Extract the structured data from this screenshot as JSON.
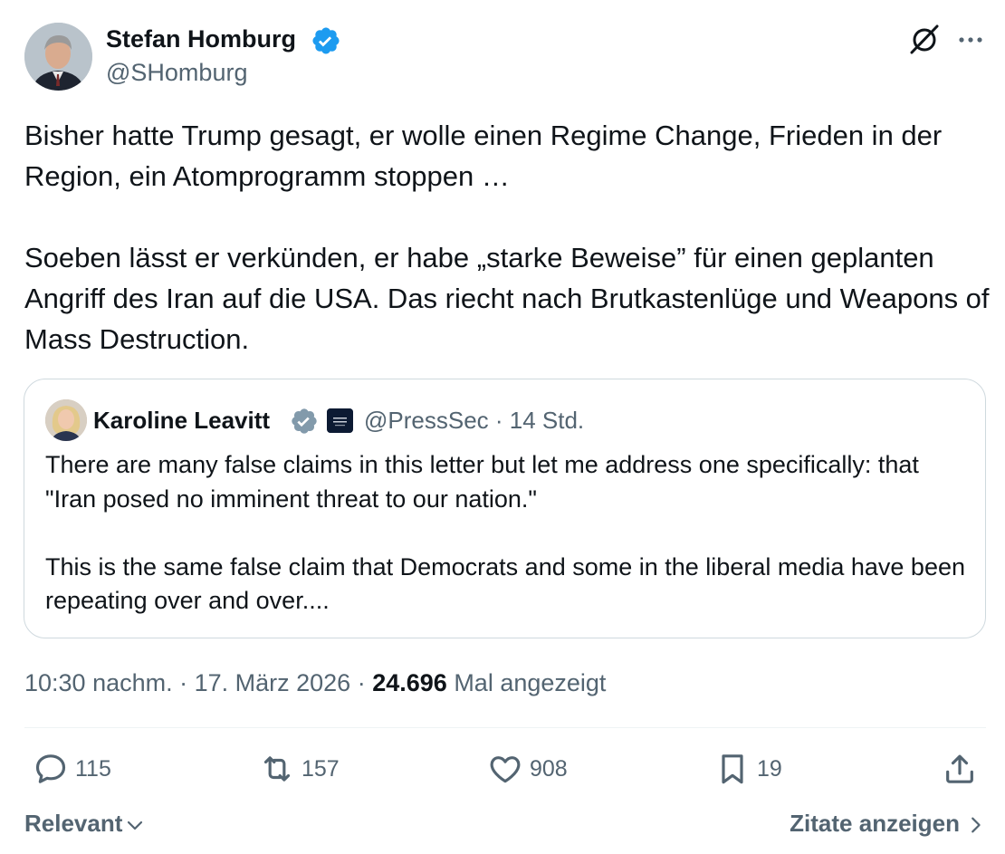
{
  "author": {
    "name": "Stefan Homburg",
    "handle": "@SHomburg"
  },
  "tweet": {
    "text": "Bisher hatte Trump gesagt, er wolle einen Regime Change, Frieden in der Region, ein Atomprogramm stoppen …\n\nSoeben lässt er verkünden, er habe „starke Beweise” für einen geplanten Angriff des Iran auf die USA. Das riecht nach Brutkastenlüge und Weapons of Mass Destruction."
  },
  "quote": {
    "name": "Karoline Leavitt",
    "handle_time": "@PressSec · 14 Std.",
    "text": "There are many false claims in this letter but let me address one specifically: that \"Iran posed no imminent threat to our nation.\"\n\nThis is the same false claim that Democrats and some in the liberal media have been repeating over and over...."
  },
  "meta": {
    "timestamp": "10:30 nachm. · 17. März 2026 · ",
    "views_count": "24.696",
    "views_label": "Mal angezeigt"
  },
  "actions": {
    "replies": "115",
    "reposts": "157",
    "likes": "908",
    "bookmarks": "19"
  },
  "footer": {
    "sort_label": "Relevant",
    "quotes_link": "Zitate anzeigen"
  },
  "colors": {
    "verified": "#1d9bf0",
    "text_secondary": "#536471",
    "text_primary": "#0f1419",
    "border": "#cfd9de"
  },
  "icons": {
    "grok": "grok-icon",
    "more": "more-icon",
    "reply": "reply-icon",
    "repost": "repost-icon",
    "like": "heart-icon",
    "bookmark": "bookmark-icon",
    "share": "share-icon"
  }
}
